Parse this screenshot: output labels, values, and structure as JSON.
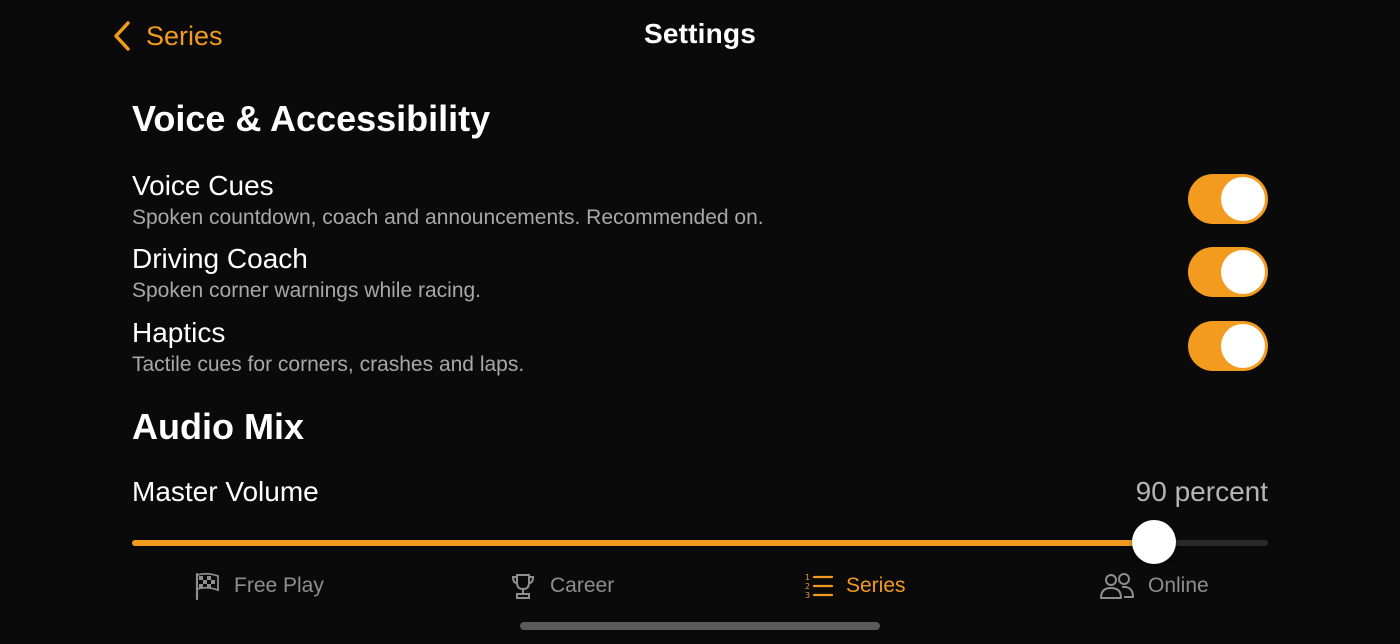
{
  "nav": {
    "back_label": "Series",
    "title": "Settings"
  },
  "sections": {
    "voice": {
      "title": "Voice & Accessibility",
      "rows": [
        {
          "title": "Voice Cues",
          "subtitle": "Spoken countdown, coach and announcements. Recommended on.",
          "enabled": true
        },
        {
          "title": "Driving Coach",
          "subtitle": "Spoken corner warnings while racing.",
          "enabled": true
        },
        {
          "title": "Haptics",
          "subtitle": "Tactile cues for corners, crashes and laps.",
          "enabled": true
        }
      ]
    },
    "audio": {
      "title": "Audio Mix",
      "master_volume": {
        "label": "Master Volume",
        "value_text": "90 percent",
        "value": 0.9
      }
    }
  },
  "tabs": [
    {
      "label": "Free Play",
      "icon": "checkered-flag-icon",
      "active": false
    },
    {
      "label": "Career",
      "icon": "trophy-icon",
      "active": false
    },
    {
      "label": "Series",
      "icon": "numbered-list-icon",
      "active": true
    },
    {
      "label": "Online",
      "icon": "people-icon",
      "active": false
    }
  ],
  "colors": {
    "accent": "#f39b1f",
    "background": "#0a0a0a",
    "inactive": "#8e8e8e"
  }
}
